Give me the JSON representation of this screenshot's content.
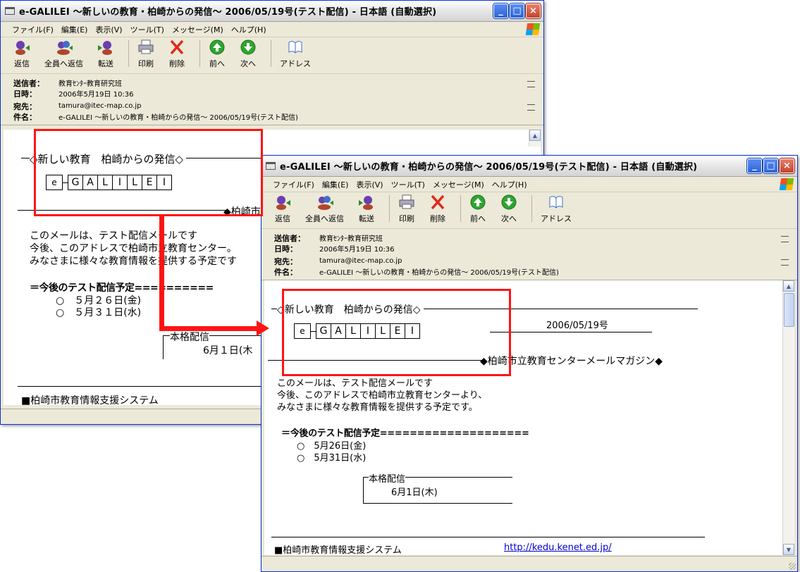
{
  "window": {
    "title": "e-GALILEI ～新しいの教育・柏崎からの発信～ 2006/05/19号(テスト配信) - 日本語 (自動選択)",
    "buttons": {
      "minimize": "_",
      "maximize": "□",
      "close": "×"
    }
  },
  "menu": [
    "ファイル(F)",
    "編集(E)",
    "表示(V)",
    "ツール(T)",
    "メッセージ(M)",
    "ヘルプ(H)"
  ],
  "toolbar": [
    {
      "label": "返信",
      "icon": "reply-icon"
    },
    {
      "label": "全員へ返信",
      "icon": "reply-all-icon"
    },
    {
      "label": "転送",
      "icon": "forward-icon"
    },
    {
      "label": "印刷",
      "icon": "print-icon"
    },
    {
      "label": "削除",
      "icon": "delete-icon"
    },
    {
      "label": "前へ",
      "icon": "previous-icon"
    },
    {
      "label": "次へ",
      "icon": "next-icon"
    },
    {
      "label": "アドレス",
      "icon": "address-book-icon"
    }
  ],
  "headers": {
    "from_label": "送信者：",
    "from": "教育ｾﾝﾀｰ教育研究班",
    "date_label": "日時：",
    "date": "2006年5月19日 10:36",
    "to_label": "宛先：",
    "to": "tamura@itec-map.co.jp",
    "subject_label": "件名：",
    "subject": "e-GALILEI ～新しいの教育・柏崎からの発信～ 2006/05/19号(テスト配信)"
  },
  "message": {
    "banner": "◇新しい教育　柏崎からの発信◇",
    "logo_e": "e",
    "logo_letters": [
      "G",
      "A",
      "L",
      "I",
      "L",
      "E",
      "I"
    ],
    "issue_date": "2006/05/19号",
    "center_line": "◆柏崎市立教育センターメールマガジン◆",
    "center_short": "◆柏崎市",
    "intro": [
      "このメールは、テスト配信メールです",
      "今後、このアドレスで柏崎市立教育センターより、",
      "みなさまに様々な教育情報を提供する予定です。"
    ],
    "intro_old": [
      "このメールは、テスト配信メールです",
      "今後、このアドレスで柏崎市立教育センター。",
      "みなさまに様々な教育情報を提供する予定です"
    ],
    "schedule_heading": "＝今後のテスト配信予定====================",
    "schedule_heading_old": "＝今後のテスト配信予定==========",
    "schedule": [
      "○　5月26日(金)",
      "○　5月31日(水)"
    ],
    "schedule_old": [
      "○　５月２６日(金)",
      "○　５月３１日(水)"
    ],
    "launch_label": "本格配信",
    "launch_date": "6月1日(木)",
    "launch_date_old": "6月１日(木",
    "footer": "■柏崎市教育情報支援システム",
    "footer_url": "http://kedu.kenet.ed.jp/"
  },
  "colors": {
    "highlight": "#ff1414",
    "chrome": "#ece9d8",
    "titlebar_border": "#0831d9"
  }
}
